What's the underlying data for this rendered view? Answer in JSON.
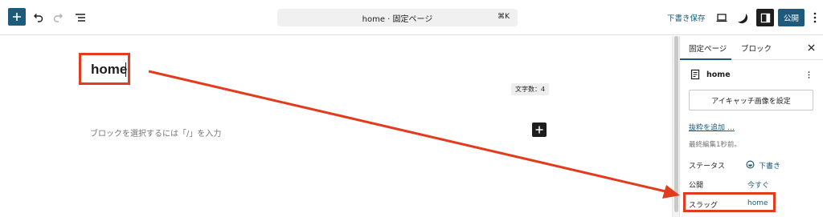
{
  "header": {
    "document_title": "home · 固定ページ",
    "shortcut": "⌘K",
    "save_draft_label": "下書き保存",
    "publish_label": "公開"
  },
  "editor": {
    "post_title": "home",
    "char_count": "文字数：4",
    "block_placeholder": "ブロックを選択するには「/」を入力"
  },
  "sidebar": {
    "tabs": [
      {
        "label": "固定ページ",
        "active": true
      },
      {
        "label": "ブロック",
        "active": false
      }
    ],
    "page_name": "home",
    "featured_image_button": "アイキャッチ画像を設定",
    "add_excerpt_link": "抜粋を追加 …",
    "last_edited": "最終編集1秒前。",
    "rows": [
      {
        "label": "ステータス",
        "value": "下書き"
      },
      {
        "label": "公開",
        "value": "今すぐ"
      },
      {
        "label": "スラッグ",
        "value": "home"
      }
    ]
  },
  "colors": {
    "accent": "#1e5a7a",
    "annotation": "#e23c1e",
    "dark": "#1e1e1e"
  }
}
